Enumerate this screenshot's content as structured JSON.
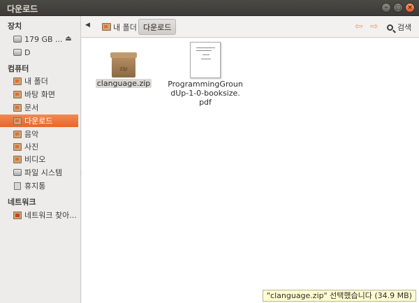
{
  "window": {
    "title": "다운로드"
  },
  "sidebar": {
    "devices_title": "장치",
    "devices": [
      {
        "label": "179 GB ...",
        "icon": "drive-icon",
        "ejectable": true
      },
      {
        "label": "D",
        "icon": "drive-icon"
      }
    ],
    "computer_title": "컴퓨터",
    "computer": [
      {
        "label": "내 폴더",
        "icon": "home-folder-icon"
      },
      {
        "label": "바탕 화면",
        "icon": "desktop-folder-icon"
      },
      {
        "label": "문서",
        "icon": "documents-folder-icon"
      },
      {
        "label": "다운로드",
        "icon": "downloads-folder-icon",
        "selected": true
      },
      {
        "label": "음악",
        "icon": "music-folder-icon"
      },
      {
        "label": "사진",
        "icon": "pictures-folder-icon"
      },
      {
        "label": "비디오",
        "icon": "videos-folder-icon"
      },
      {
        "label": "파일 시스템",
        "icon": "filesystem-icon"
      },
      {
        "label": "휴지통",
        "icon": "trash-icon"
      }
    ],
    "network_title": "네트워크",
    "network": [
      {
        "label": "네트워크 찾아...",
        "icon": "network-icon"
      }
    ]
  },
  "toolbar": {
    "breadcrumb_home": "내 폴더",
    "breadcrumb_current": "다운로드",
    "search_label": "검색"
  },
  "files": [
    {
      "name": "clanguage.zip",
      "type": "zip",
      "selected": true,
      "icon_text": "zip"
    },
    {
      "name_lines": [
        "ProgrammingGroun",
        "dUp-1-0-booksize.",
        "pdf"
      ],
      "type": "pdf"
    }
  ],
  "status": {
    "text": "\"clanguage.zip\" 선택했습니다 (34.9 MB)"
  },
  "colors": {
    "accent": "#e8652b",
    "titlebar": "#3c3b37",
    "status_bg": "#fffdd0"
  }
}
